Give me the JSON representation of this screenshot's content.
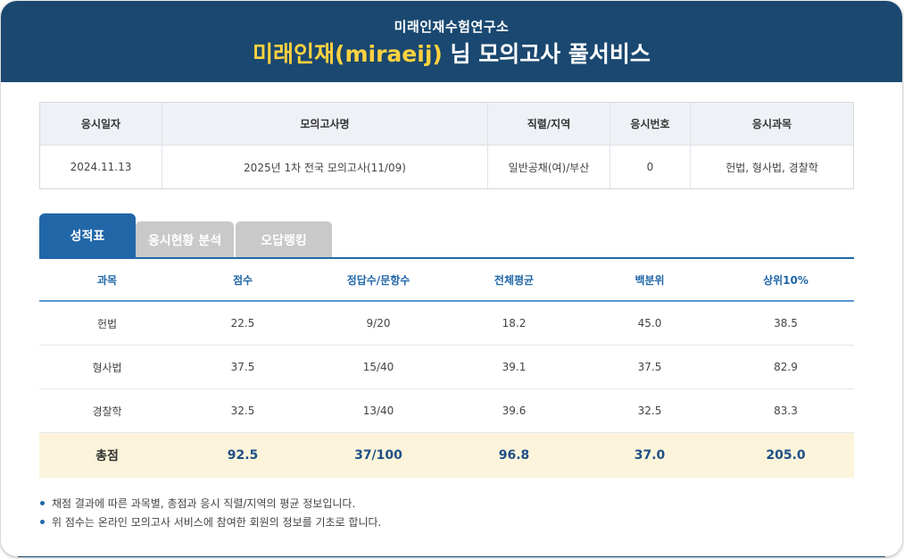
{
  "header": {
    "org": "미래인재수험연구소",
    "title_highlight": "미래인재(miraeij)",
    "title_rest": " 님 모의고사 풀서비스"
  },
  "info_table": {
    "headers": [
      "응시일자",
      "모의고사명",
      "직렬/지역",
      "응시번호",
      "응시과목"
    ],
    "values": [
      "2024.11.13",
      "2025년 1차 전국 모의고사(11/09)",
      "일반공채(여)/부산",
      "0",
      "헌법, 형사법, 경찰학"
    ]
  },
  "tabs": [
    "성적표",
    "응시현황 분석",
    "오답랭킹"
  ],
  "score_table": {
    "headers": [
      "과목",
      "점수",
      "정답수/문항수",
      "전체평균",
      "백분위",
      "상위10%"
    ],
    "rows": [
      [
        "헌법",
        "22.5",
        "9/20",
        "18.2",
        "45.0",
        "38.5"
      ],
      [
        "형사법",
        "37.5",
        "15/40",
        "39.1",
        "37.5",
        "82.9"
      ],
      [
        "경찰학",
        "32.5",
        "13/40",
        "39.6",
        "32.5",
        "83.3"
      ]
    ],
    "total": [
      "총점",
      "92.5",
      "37/100",
      "96.8",
      "37.0",
      "205.0"
    ]
  },
  "notes": [
    "채점 결과에 따른 과목별, 총점과 응시 직렬/지역의 평균 정보입니다.",
    "위 점수는 온라인 모의고사 서비스에 참여한 회원의 정보를 기초로 합니다."
  ],
  "colors": {
    "header_bg": "#1a4870",
    "highlight": "#ffd23f",
    "accent": "#2167a8",
    "total_bg": "#fbf4db"
  }
}
